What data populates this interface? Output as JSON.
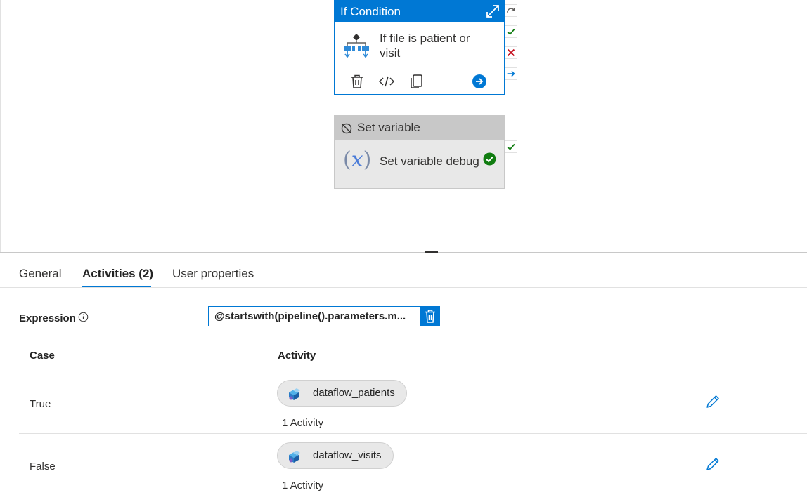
{
  "canvas": {
    "if_node": {
      "title": "If Condition",
      "name": "If file is patient or visit",
      "icons": [
        "expand-icon",
        "if-condition-icon",
        "delete-icon",
        "code-icon",
        "copy-icon",
        "navigate-arrow-icon"
      ]
    },
    "handles": [
      "skip-icon",
      "success-icon",
      "failure-icon",
      "completion-icon"
    ],
    "set_variable_node": {
      "title": "Set variable",
      "name": "Set variable debug",
      "disabled": true,
      "status": "succeeded"
    }
  },
  "panel": {
    "tabs": [
      {
        "label": "General",
        "active": false
      },
      {
        "label": "Activities (2)",
        "active": true
      },
      {
        "label": "User properties",
        "active": false
      }
    ],
    "expression": {
      "label": "Expression",
      "value": "@startswith(pipeline().parameters.m..."
    },
    "table": {
      "headers": {
        "case": "Case",
        "activity": "Activity"
      },
      "rows": [
        {
          "case": "True",
          "activity_name": "dataflow_patients",
          "count": "1 Activity"
        },
        {
          "case": "False",
          "activity_name": "dataflow_visits",
          "count": "1 Activity"
        }
      ]
    }
  },
  "colors": {
    "accent": "#0078d4",
    "success": "#107c10",
    "failure": "#c50f1f"
  }
}
